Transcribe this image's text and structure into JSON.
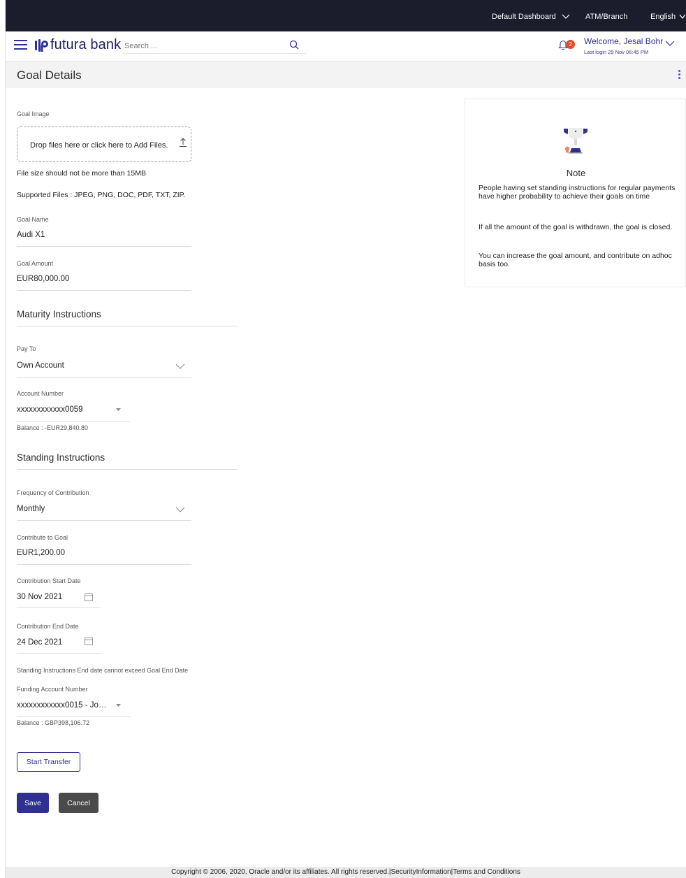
{
  "topbar": {
    "dashboard": "Default Dashboard",
    "atm_branch": "ATM/Branch",
    "language": "English"
  },
  "header": {
    "brand": "futura bank",
    "search_placeholder": "Search ...",
    "notification_count": "2",
    "welcome": "Welcome, Jesal Bohr",
    "last_login": "Last login 29 Nov 06:45 PM"
  },
  "page": {
    "title": "Goal Details"
  },
  "goal_image": {
    "label": "Goal Image",
    "dropzone_text": "Drop files here or click here to Add Files.",
    "size_note": "File size should not be more than 15MB",
    "supported_files": "Supported Files : JPEG, PNG, DOC, PDF, TXT, ZIP."
  },
  "goal_name": {
    "label": "Goal Name",
    "value": "Audi X1"
  },
  "goal_amount": {
    "label": "Goal Amount",
    "value": "EUR80,000.00"
  },
  "maturity": {
    "title": "Maturity Instructions",
    "pay_to_label": "Pay To",
    "pay_to_value": "Own Account",
    "account_label": "Account Number",
    "account_value": "xxxxxxxxxxxx0059",
    "balance": "Balance : -EUR29,840.80"
  },
  "standing": {
    "title": "Standing Instructions",
    "frequency_label": "Frequency of Contribution",
    "frequency_value": "Monthly",
    "contribute_label": "Contribute to Goal",
    "contribute_value": "EUR1,200.00",
    "start_label": "Contribution Start Date",
    "start_value": "30 Nov 2021",
    "end_label": "Contribution End Date",
    "end_value": "24 Dec 2021",
    "end_date_note": "Standing Instructions End date cannot exceed Goal End Date",
    "funding_label": "Funding Account Number",
    "funding_value": "xxxxxxxxxxxx0015 - Jo…",
    "funding_balance": "Balance : GBP398,106.72"
  },
  "buttons": {
    "start_transfer": "Start Transfer",
    "save": "Save",
    "cancel": "Cancel"
  },
  "note": {
    "title": "Note",
    "p1": "People having set standing instructions for regular payments have higher probability to achieve their goals on time",
    "p2": "If all the amount of the goal is withdrawn, the goal is closed.",
    "p3": "You can increase the goal amount, and contribute on adhoc basis too."
  },
  "footer": {
    "text": "Copyright © 2006, 2020, Oracle and/or its affiliates. All rights reserved.|SecurityInformation|Terms and Conditions"
  },
  "colors": {
    "topbar": "#1b1c2c",
    "brand": "#2f3190",
    "badge": "#e44b2a",
    "cancel": "#4a4a4a"
  }
}
